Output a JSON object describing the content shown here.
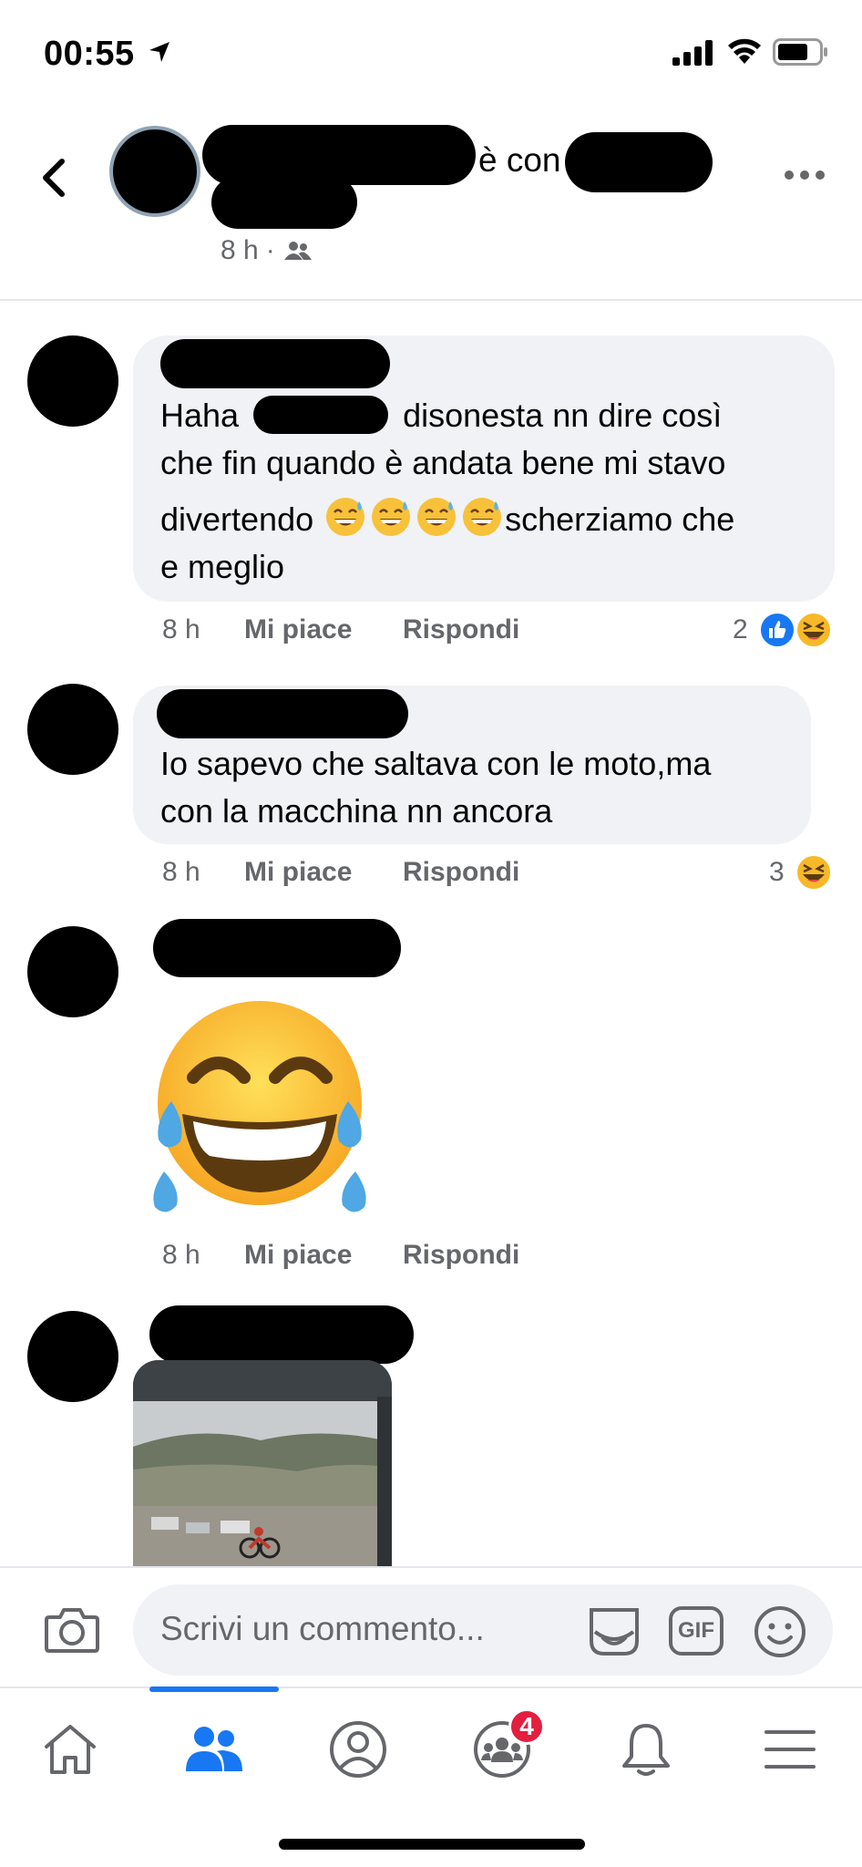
{
  "status_bar": {
    "time": "00:55"
  },
  "post_header": {
    "with_text": "è con",
    "time": "8 h",
    "separator": "·",
    "audience_icon": "friends-icon",
    "more_icon": "more-dots-icon"
  },
  "comments": [
    {
      "text_lines": [
        "Haha",
        "disonesta nn dire così",
        "che fin quando è andata bene mi stavo",
        "divertendo",
        "scherziamo che",
        "e meglio"
      ],
      "emoji": "sweat-smile",
      "time": "8 h",
      "like_label": "Mi piace",
      "reply_label": "Rispondi",
      "reaction_count": "2",
      "reactions": [
        "like",
        "haha"
      ]
    },
    {
      "text_lines": [
        "Io sapevo che saltava con le moto,ma",
        "con la macchina nn ancora"
      ],
      "time": "8 h",
      "like_label": "Mi piace",
      "reply_label": "Rispondi",
      "reaction_count": "3",
      "reactions": [
        "haha"
      ]
    },
    {
      "sticker": "joy-emoji",
      "time": "8 h",
      "like_label": "Mi piace",
      "reply_label": "Rispondi"
    },
    {
      "attachment": "photo"
    }
  ],
  "composer": {
    "placeholder": "Scrivi un commento...",
    "gif_label": "GIF"
  },
  "bottom_nav": {
    "items": [
      "home-icon",
      "groups-icon",
      "profile-icon",
      "communities-icon",
      "notifications-icon",
      "menu-icon"
    ],
    "communities_badge": "4",
    "active": "groups-icon"
  },
  "colors": {
    "accent": "#1877f2",
    "bubble": "#f0f2f5",
    "secondary_text": "#65676b",
    "badge": "#e41e3f"
  }
}
